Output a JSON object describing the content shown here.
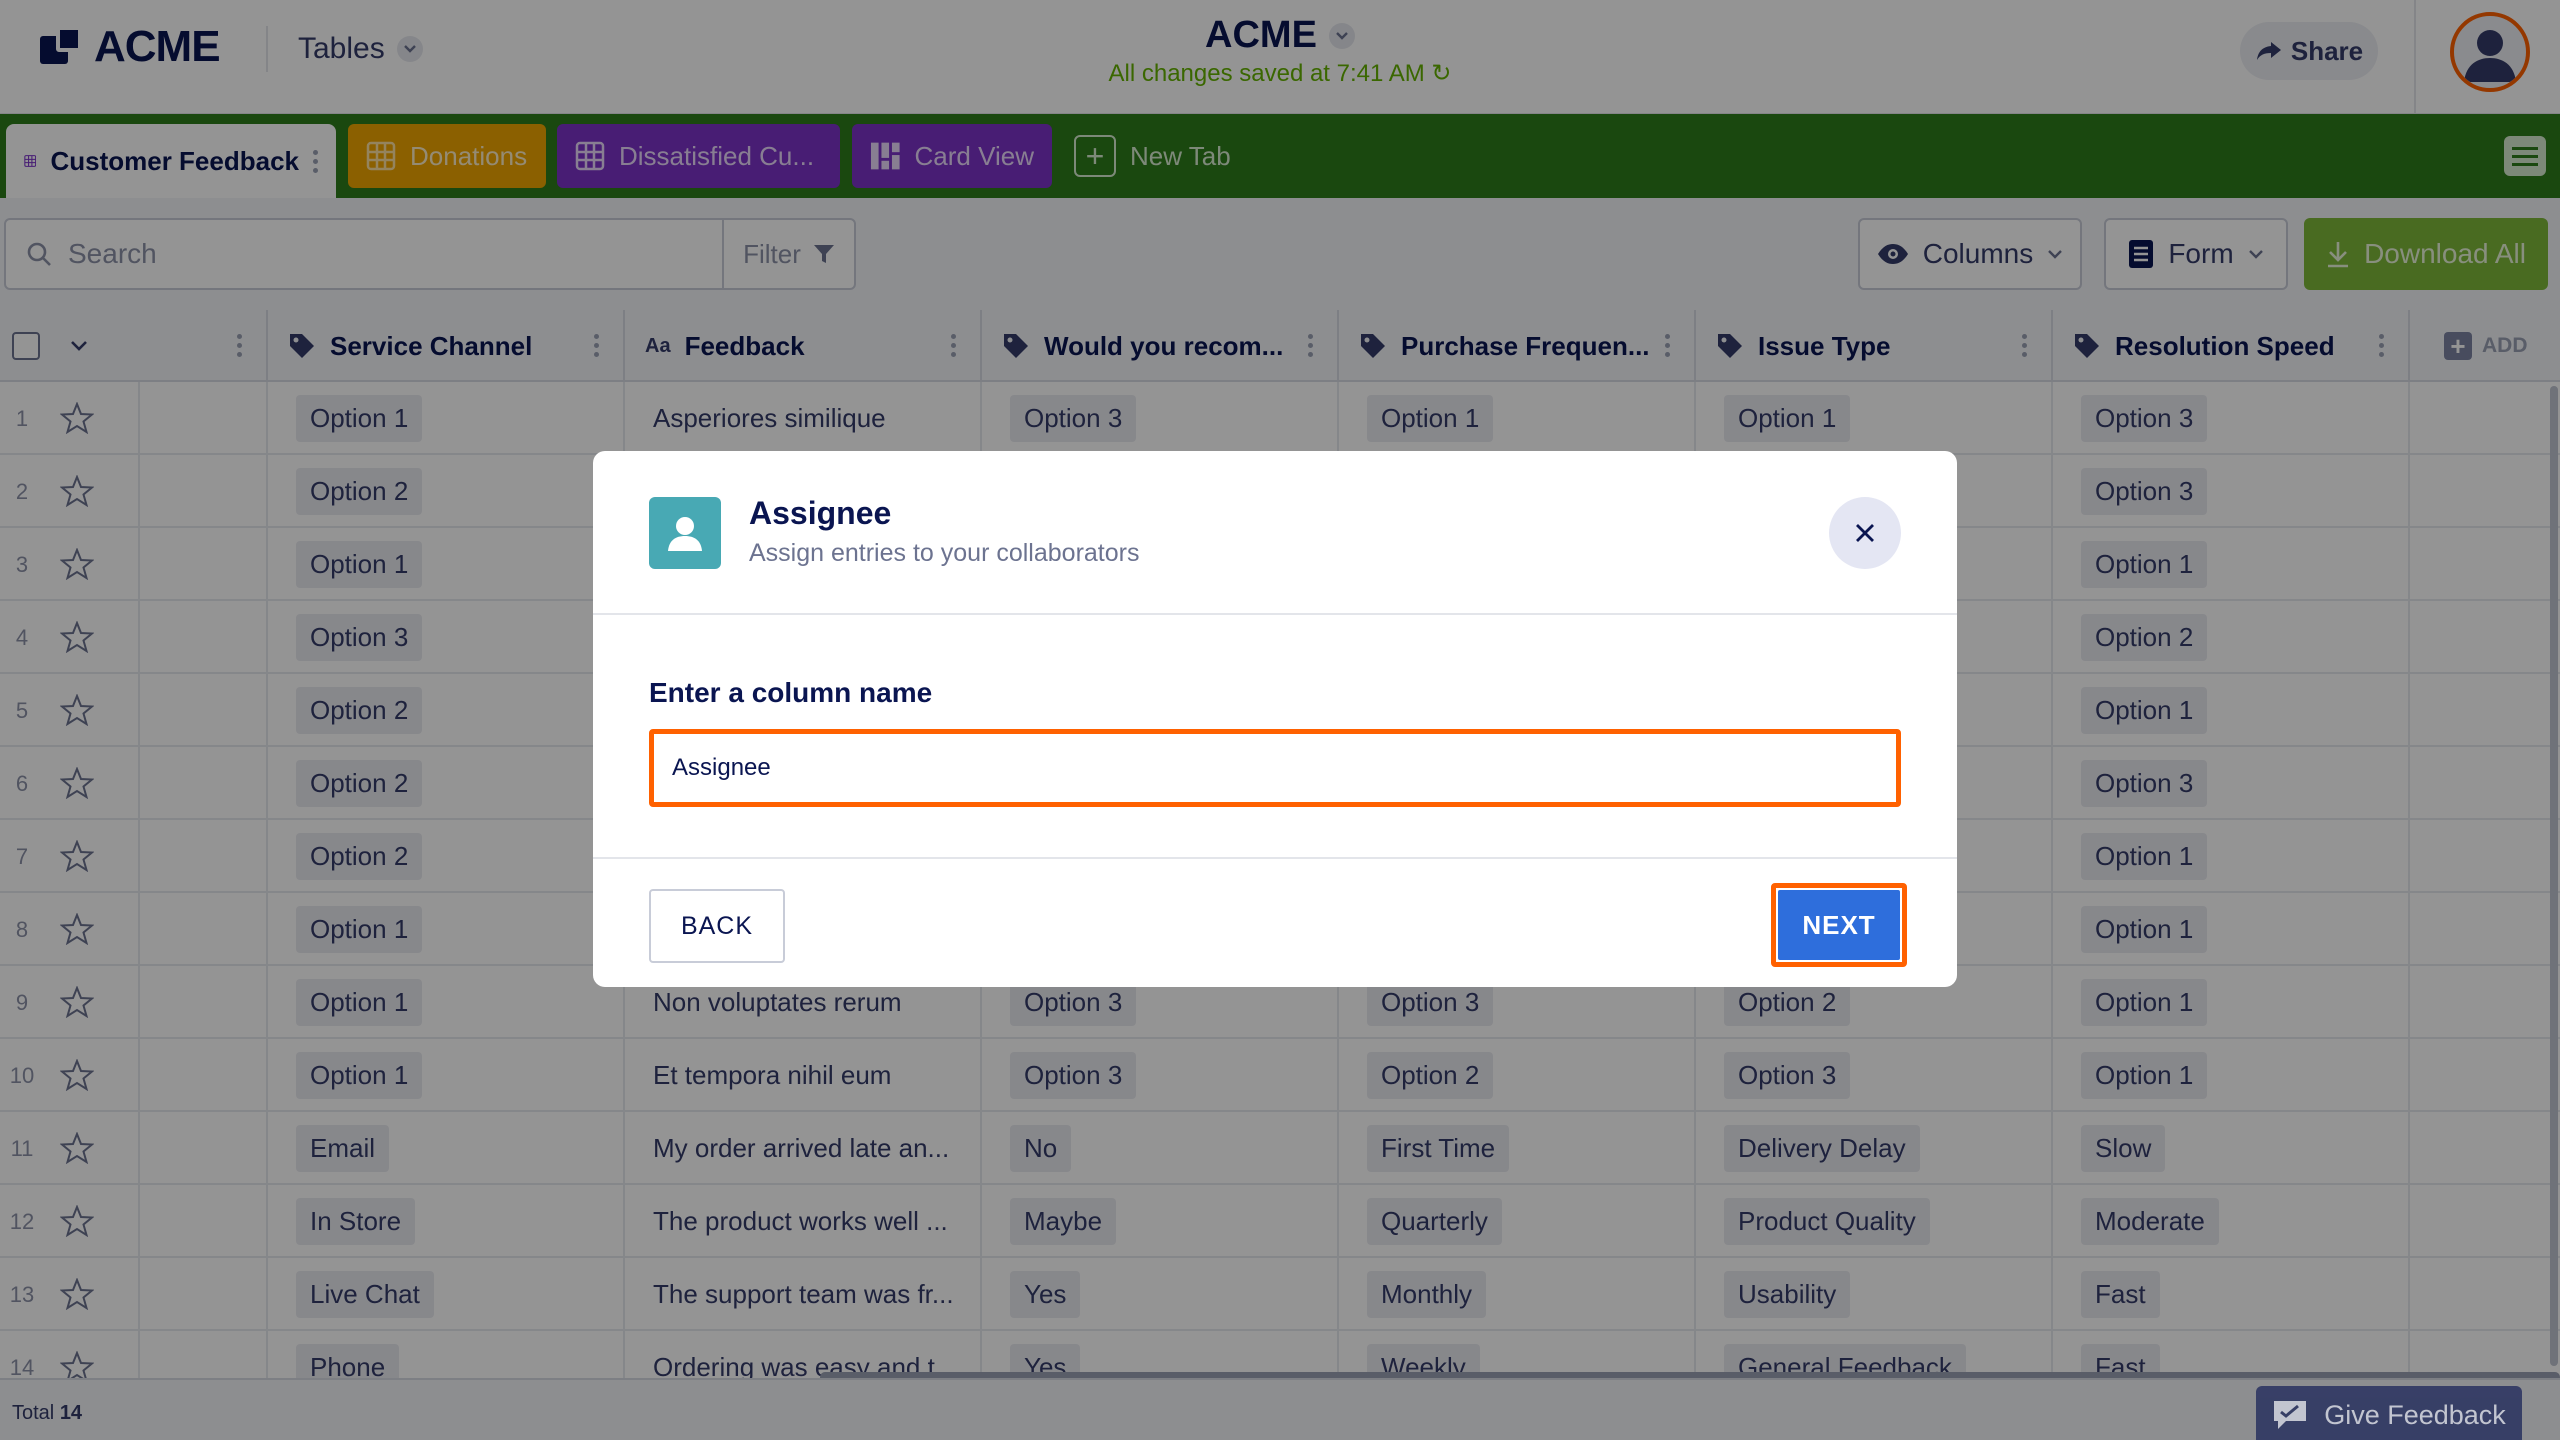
{
  "header": {
    "logo_text": "ACME",
    "tables_label": "Tables",
    "title": "ACME",
    "save_status": "All changes saved at 7:41 AM",
    "share_label": "Share"
  },
  "tabs": [
    {
      "label": "Customer Feedback",
      "color": "#ffffff"
    },
    {
      "label": "Donations",
      "color": "#f0a500"
    },
    {
      "label": "Dissatisfied Cu...",
      "color": "#7c32c9"
    },
    {
      "label": "Card View",
      "color": "#7c32c9"
    },
    {
      "label": "New Tab"
    }
  ],
  "toolbar": {
    "search_placeholder": "Search",
    "filter_label": "Filter",
    "columns_label": "Columns",
    "form_label": "Form",
    "download_label": "Download All"
  },
  "columns": [
    {
      "label": "Service Channel",
      "icon": "tag-icon"
    },
    {
      "label": "Feedback",
      "icon": "text-icon",
      "icon_text": "Aa"
    },
    {
      "label": "Would you recom...",
      "icon": "tag-icon"
    },
    {
      "label": "Purchase Frequen...",
      "icon": "tag-icon"
    },
    {
      "label": "Issue Type",
      "icon": "tag-icon"
    },
    {
      "label": "Resolution Speed",
      "icon": "tag-icon"
    }
  ],
  "add_column_label": "ADD",
  "rows": [
    {
      "num": "1",
      "c": [
        "Option 1",
        "Asperiores similique",
        "Option 3",
        "Option 1",
        "Option 1",
        "Option 3"
      ]
    },
    {
      "num": "2",
      "c": [
        "Option 2",
        "",
        "",
        "",
        "",
        "Option 3"
      ]
    },
    {
      "num": "3",
      "c": [
        "Option 1",
        "",
        "",
        "",
        "",
        "Option 1"
      ]
    },
    {
      "num": "4",
      "c": [
        "Option 3",
        "",
        "",
        "",
        "",
        "Option 2"
      ]
    },
    {
      "num": "5",
      "c": [
        "Option 2",
        "",
        "",
        "",
        "",
        "Option 1"
      ]
    },
    {
      "num": "6",
      "c": [
        "Option 2",
        "",
        "",
        "",
        "",
        "Option 3"
      ]
    },
    {
      "num": "7",
      "c": [
        "Option 2",
        "",
        "",
        "",
        "",
        "Option 1"
      ]
    },
    {
      "num": "8",
      "c": [
        "Option 1",
        "",
        "",
        "",
        "",
        "Option 1"
      ]
    },
    {
      "num": "9",
      "c": [
        "Option 1",
        "Non voluptates rerum",
        "Option 3",
        "Option 3",
        "Option 2",
        "Option 1"
      ]
    },
    {
      "num": "10",
      "c": [
        "Option 1",
        "Et tempora nihil eum",
        "Option 3",
        "Option 2",
        "Option 3",
        "Option 1"
      ]
    },
    {
      "num": "11",
      "c": [
        "Email",
        "My order arrived late an...",
        "No",
        "First Time",
        "Delivery Delay",
        "Slow"
      ]
    },
    {
      "num": "12",
      "c": [
        "In Store",
        "The product works well ...",
        "Maybe",
        "Quarterly",
        "Product Quality",
        "Moderate"
      ]
    },
    {
      "num": "13",
      "c": [
        "Live Chat",
        "The support team was fr...",
        "Yes",
        "Monthly",
        "Usability",
        "Fast"
      ]
    },
    {
      "num": "14",
      "c": [
        "Phone",
        "Ordering was easy and t...",
        "Yes",
        "Weekly",
        "General Feedback",
        "Fast"
      ]
    }
  ],
  "footer": {
    "total_label": "Total",
    "total_count": "14",
    "feedback_label": "Give Feedback"
  },
  "modal": {
    "title": "Assignee",
    "subtitle": "Assign entries to your collaborators",
    "field_label": "Enter a column name",
    "field_value": "Assignee",
    "back_label": "BACK",
    "next_label": "NEXT"
  },
  "colors": {
    "brand_navy": "#0a1551",
    "tabs_bar_green": "#2e7d1a",
    "focus_orange": "#ff6100",
    "next_blue": "#2e6edc",
    "save_green": "#64b200"
  }
}
